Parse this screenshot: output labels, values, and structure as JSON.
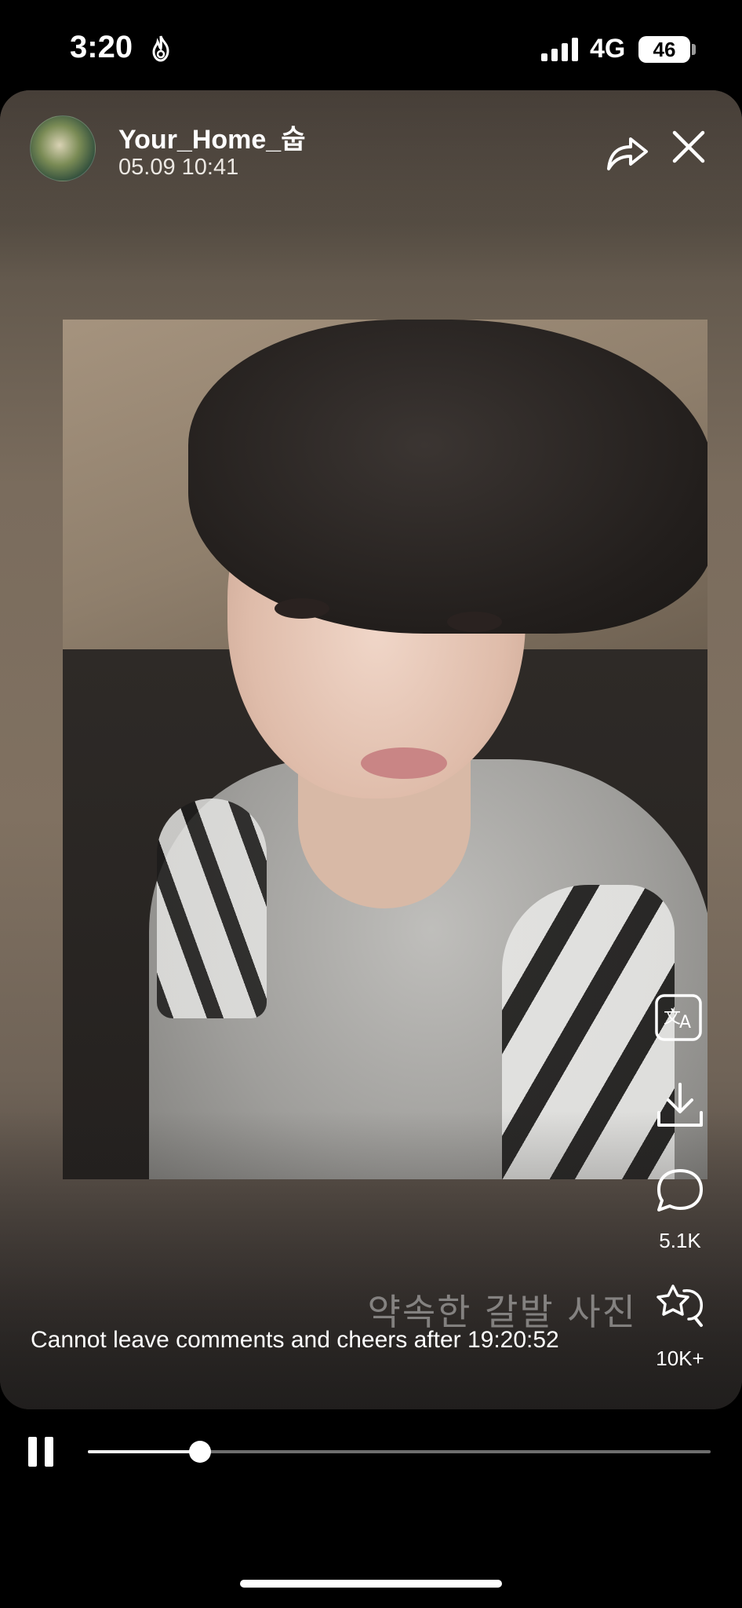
{
  "status_bar": {
    "time": "3:20",
    "network": "4G",
    "battery": "46",
    "icons": [
      "flame-icon",
      "signal-icon"
    ]
  },
  "post": {
    "username": "Your_Home_숩",
    "date": "05.09 10:41",
    "caption_overlay": "약속한 갈발 사진",
    "comment_notice": "Cannot leave comments and cheers after 19:20:52"
  },
  "actions": {
    "comment_count": "5.1K",
    "cheer_count": "10K+",
    "icons": [
      "share-icon",
      "close-icon",
      "translate-icon",
      "download-icon",
      "comment-icon",
      "cheer-icon"
    ]
  },
  "player": {
    "progress": 0.18,
    "state_icon": "pause-icon"
  },
  "colors": {
    "background": "#000000",
    "card_tone": "#7a6c5d",
    "text": "#ffffff"
  }
}
